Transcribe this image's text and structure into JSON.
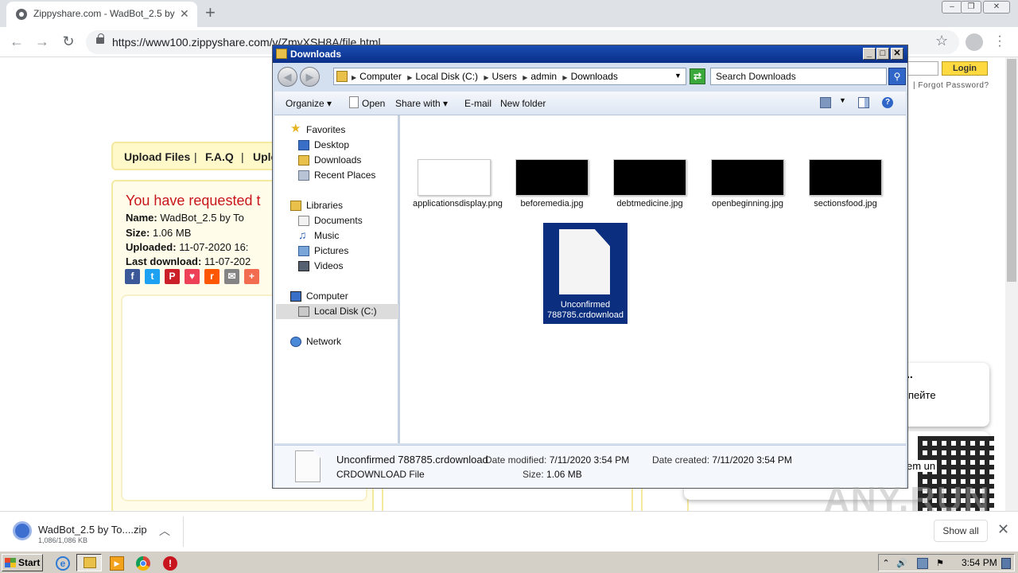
{
  "browser": {
    "tab_title": "Zippyshare.com - WadBot_2.5 by To",
    "tab_close": "✕",
    "new_tab": "+",
    "url": "https://www100.zippyshare.com/v/ZmyXSH8A/file.html",
    "window_controls": [
      "–",
      "❐",
      "✕"
    ]
  },
  "page": {
    "login_button": "Login",
    "forgot_password": "| Forgot Password?",
    "nav": [
      "Upload Files",
      "|",
      "F.A.Q",
      "|",
      "Uplo"
    ],
    "requested": "You have requested t",
    "name_label": "Name:",
    "name_value": "WadBot_2.5 by To",
    "size_label": "Size:",
    "size_value": "1.06 MB",
    "uploaded_label": "Uploaded:",
    "uploaded_value": "11-07-2020 16:",
    "last_download_label": "Last download:",
    "last_download_value": "11-07-202",
    "social": [
      {
        "icon": "facebook-icon",
        "glyph": "f",
        "color": "#3b5998"
      },
      {
        "icon": "twitter-icon",
        "glyph": "t",
        "color": "#1da1f2"
      },
      {
        "icon": "pinterest-icon",
        "glyph": "P",
        "color": "#cb2027"
      },
      {
        "icon": "pocket-icon",
        "glyph": "♥",
        "color": "#ee4056"
      },
      {
        "icon": "reddit-icon",
        "glyph": "r",
        "color": "#ff5700"
      },
      {
        "icon": "email-icon",
        "glyph": "✉",
        "color": "#848484"
      },
      {
        "icon": "more-icon",
        "glyph": "+",
        "color": "#f26c4f"
      }
    ],
    "popup_dots": "..",
    "popup_text": "пейте",
    "popup2_text": "em un"
  },
  "explorer": {
    "title": "Downloads",
    "breadcrumbs": [
      "Computer",
      "Local Disk (C:)",
      "Users",
      "admin",
      "Downloads"
    ],
    "search_placeholder": "Search Downloads",
    "commands": {
      "organize": "Organize ▾",
      "open": "Open",
      "share_with": "Share with ▾",
      "email": "E-mail",
      "new_folder": "New folder"
    },
    "nav": {
      "favorites": "Favorites",
      "desktop": "Desktop",
      "downloads": "Downloads",
      "recent_places": "Recent Places",
      "libraries": "Libraries",
      "documents": "Documents",
      "music": "Music",
      "pictures": "Pictures",
      "videos": "Videos",
      "computer": "Computer",
      "local_disk": "Local Disk (C:)",
      "network": "Network"
    },
    "files": [
      {
        "name": "applicationsdisplay.png",
        "thumb": "light"
      },
      {
        "name": "beforemedia.jpg",
        "thumb": "dark"
      },
      {
        "name": "debtmedicine.jpg",
        "thumb": "dark"
      },
      {
        "name": "openbeginning.jpg",
        "thumb": "dark"
      },
      {
        "name": "sectionsfood.jpg",
        "thumb": "dark"
      }
    ],
    "selected_file": "Unconfirmed 788785.crdownload",
    "details": {
      "name": "Unconfirmed 788785.crdownload",
      "type": "CRDOWNLOAD File",
      "date_modified_label": "Date modified:",
      "date_modified": "7/11/2020 3:54 PM",
      "size_label": "Size:",
      "size": "1.06 MB",
      "date_created_label": "Date created:",
      "date_created": "7/11/2020 3:54 PM"
    }
  },
  "download_shelf": {
    "file_name": "WadBot_2.5 by To....zip",
    "progress_text": "1,086/1,086 KB",
    "show_all": "Show all",
    "close": "✕"
  },
  "taskbar": {
    "start": "Start",
    "clock": "3:54 PM"
  }
}
